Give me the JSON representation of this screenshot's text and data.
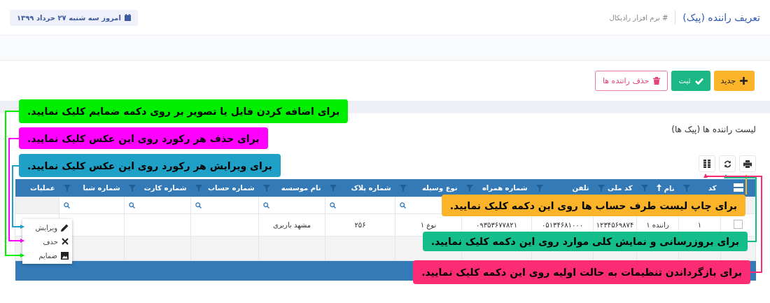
{
  "header": {
    "title": "تعریف راننده (پیک)",
    "breadcrumb": "# نرم افزار رادیکال",
    "date": "امروز سه شنبه ۲۷ خرداد ۱۳۹۹"
  },
  "actions": [
    {
      "kind": "new",
      "label": "جدید"
    },
    {
      "kind": "save",
      "label": "ثبت"
    },
    {
      "kind": "delete",
      "label": "حذف راننده ها"
    }
  ],
  "list": {
    "title": "لیست راننده ها (پیک ها)",
    "tools": [
      {
        "kind": "print"
      },
      {
        "kind": "refresh"
      },
      {
        "kind": "columns"
      }
    ],
    "columns": [
      {
        "kind": "filter",
        "label": "کد",
        "sorted": false
      },
      {
        "kind": "filter",
        "label": "نام",
        "sorted": true
      },
      {
        "kind": "filter",
        "label": "کد ملی",
        "sorted": false
      },
      {
        "kind": "filter",
        "label": "تلفن",
        "sorted": false
      },
      {
        "kind": "filter",
        "label": "شماره همراه",
        "sorted": false
      },
      {
        "kind": "filter",
        "label": "نوع وسیله",
        "sorted": false
      },
      {
        "kind": "filter",
        "label": "شماره پلاک",
        "sorted": false
      },
      {
        "kind": "filter",
        "label": "نام موسسه",
        "sorted": false
      },
      {
        "kind": "filter",
        "label": "شماره حساب",
        "sorted": false
      },
      {
        "kind": "filter",
        "label": "شماره کارت",
        "sorted": false
      },
      {
        "kind": "filter",
        "label": "شماره شبا",
        "sorted": false
      },
      {
        "kind": "plain",
        "label": "عملیات"
      }
    ],
    "rows": [
      {
        "selected": false,
        "cells": [
          "۱",
          "راننده ۱",
          "۱۲۳۴۵۶۹۸۷۴",
          "۰۵۱۳۴۶۸۱۰۰۰",
          "۰۹۳۵۳۶۷۷۸۲۱",
          "نوع ۱",
          "۲۵۶",
          "مشهد باربری"
        ]
      }
    ],
    "row_menu": [
      {
        "kind": "edit",
        "label": "ویرایش"
      },
      {
        "kind": "delete",
        "label": "حذف"
      },
      {
        "kind": "attach",
        "label": "ضمایم"
      }
    ]
  },
  "callouts": [
    {
      "color": "#00ee00",
      "text": "برای اضافه کردن فایل یا تصویر بر روی دکمه ضمایم کلیک نمایید."
    },
    {
      "color": "#ff00ff",
      "text": "برای حذف هر رکورد روی این عکس کلیک نمایید."
    },
    {
      "color": "#1fa0c6",
      "text": "برای ویرایش هر رکورد روی این عکس کلیک نمایید."
    },
    {
      "color": "#fbb42a",
      "text": "برای چاپ لیست طرف حساب ها روی این دکمه کلیک نمایید."
    },
    {
      "color": "#14bd8a",
      "text": "برای بروزرسانی و نمایش کلی موارد روی این دکمه کلیک نمایید."
    },
    {
      "color": "#fc2c74",
      "text": "برای بازگرداندن تنظیمات به حالت اولیه روی این دکمه کلیک نمایید."
    }
  ]
}
